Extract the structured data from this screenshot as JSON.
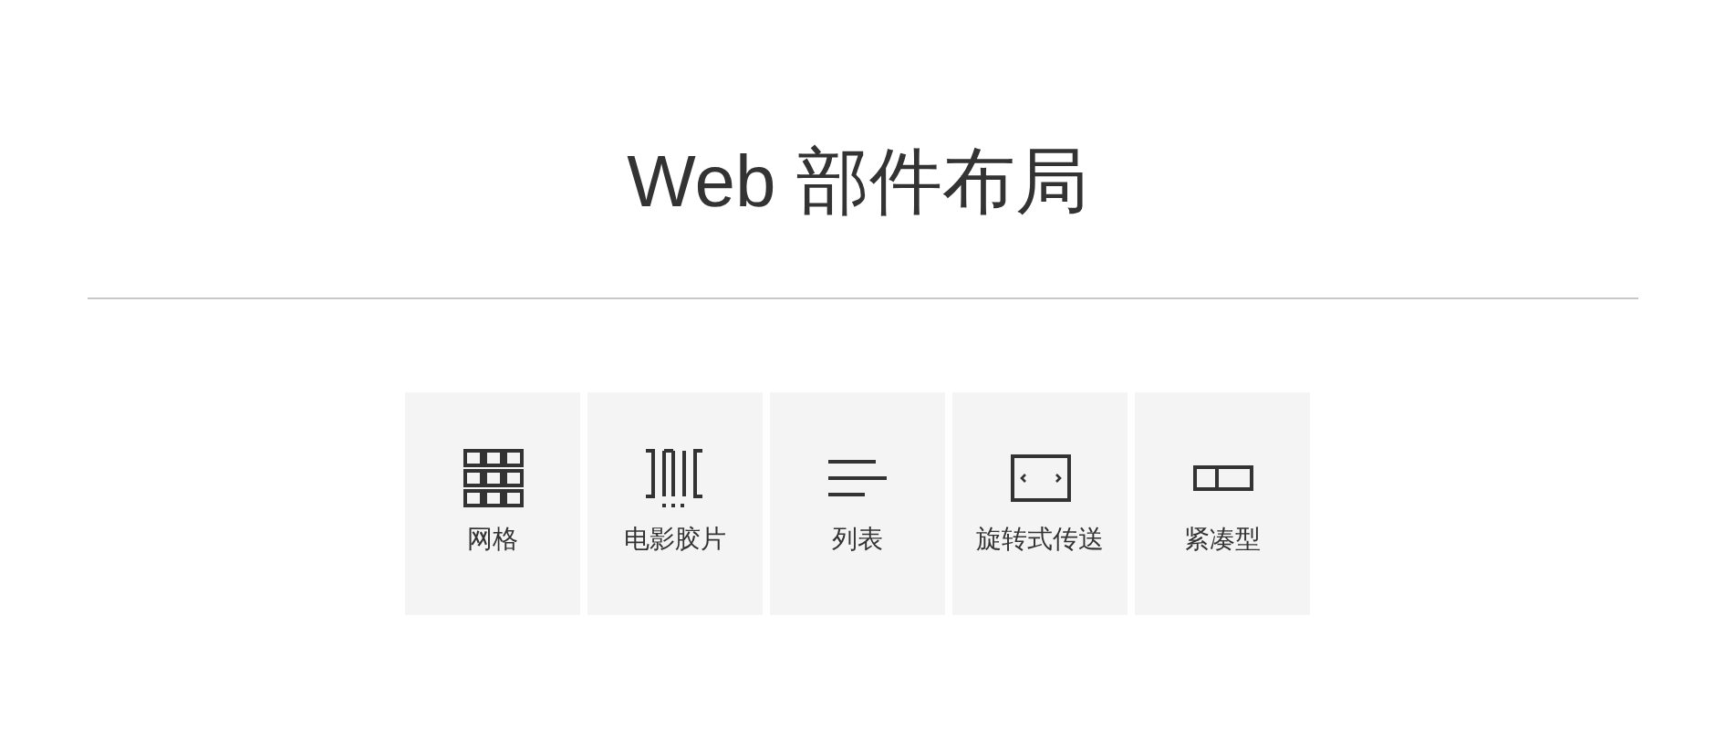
{
  "title": "Web 部件布局",
  "layouts": [
    {
      "kind": "grid",
      "label": "网格"
    },
    {
      "kind": "filmstrip",
      "label": "电影胶片"
    },
    {
      "kind": "list",
      "label": "列表"
    },
    {
      "kind": "carousel",
      "label": "旋转式传送"
    },
    {
      "kind": "compact",
      "label": "紧凑型"
    }
  ]
}
